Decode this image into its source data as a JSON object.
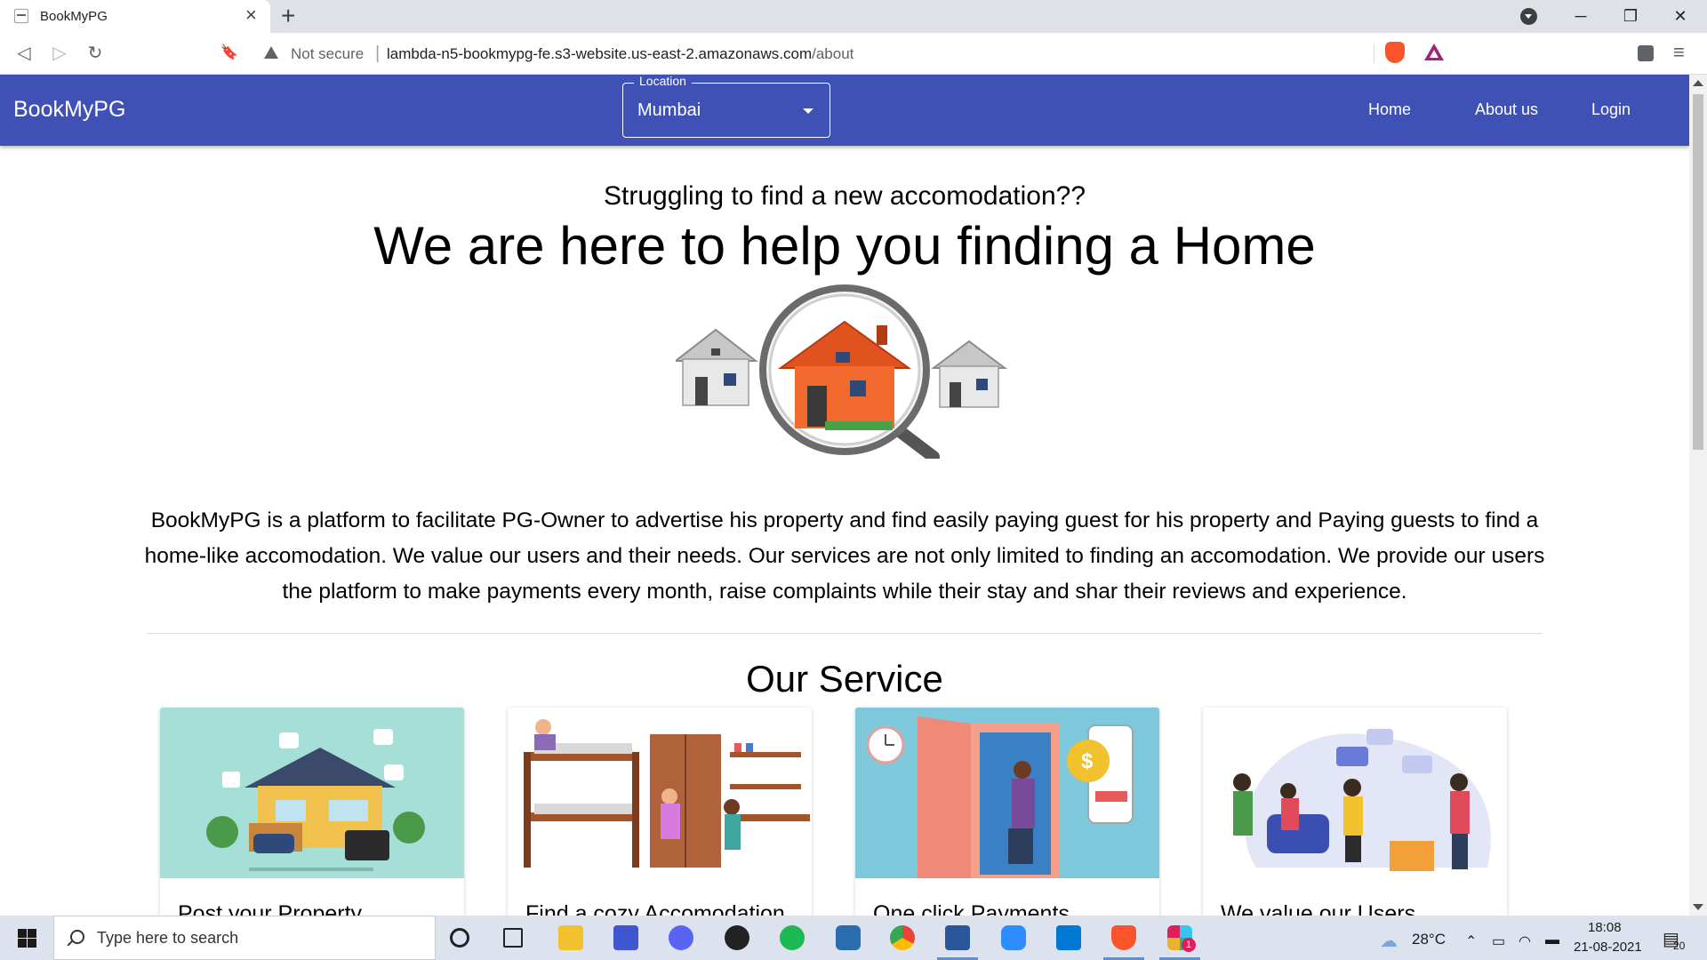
{
  "browser": {
    "tab_title": "BookMyPG",
    "tab_close": "×",
    "new_tab": "+",
    "security_label": "Not secure",
    "url_host": "lambda-n5-bookmypg-fe.s3-website.us-east-2.amazonaws.com",
    "url_path": "/about",
    "window_controls": {
      "minimize": "─",
      "restore": "❐",
      "close": "✕"
    },
    "nav": {
      "back": "◁",
      "forward": "▷",
      "reload": "↻",
      "bookmark": "🔖"
    },
    "menu": "≡"
  },
  "appbar": {
    "brand": "BookMyPG",
    "location_label": "Location",
    "location_value": "Mumbai",
    "nav_links": [
      "Home",
      "About us",
      "Login"
    ],
    "color": "#3f51b5"
  },
  "hero": {
    "subtitle": "Struggling to find a new accomodation??",
    "headline": "We are here to help you finding a Home",
    "image_icons": [
      "house-icon",
      "magnifier-house-icon",
      "house-icon"
    ]
  },
  "about": {
    "description": "BookMyPG is a platform to facilitate PG-Owner to advertise his property and find easily paying guest for his property and Paying guests to find a home-like accomodation. We value our users and their needs. Our services are not only limited to finding an accomodation. We provide our users the platform to make payments every month, raise complaints while their stay and shar their reviews and experience."
  },
  "services": {
    "title": "Our Service",
    "cards": [
      {
        "title": "Post your Property",
        "image": "smart-house-illustration",
        "bg": "#a6dfd7"
      },
      {
        "title": "Find a cozy Accomodation",
        "image": "shared-room-illustration",
        "bg": "#ffffff"
      },
      {
        "title": "One click Payments",
        "image": "payment-door-illustration",
        "bg": "#7ec8dc"
      },
      {
        "title": "We value our Users",
        "image": "users-feedback-illustration",
        "bg": "#ffffff"
      }
    ]
  },
  "taskbar": {
    "search_placeholder": "Type here to search",
    "apps": [
      "cortana-icon",
      "task-view-icon",
      "file-explorer-icon",
      "visual-studio-icon",
      "discord-icon",
      "xbox-icon",
      "spotify-icon",
      "word-reader-icon",
      "chrome-icon",
      "word-icon",
      "zoom-icon",
      "vscode-icon",
      "brave-icon",
      "slack-icon"
    ],
    "weather": "28°C",
    "time": "18:08",
    "date": "21-08-2021",
    "notifications": "20",
    "slack_badge": "1"
  }
}
